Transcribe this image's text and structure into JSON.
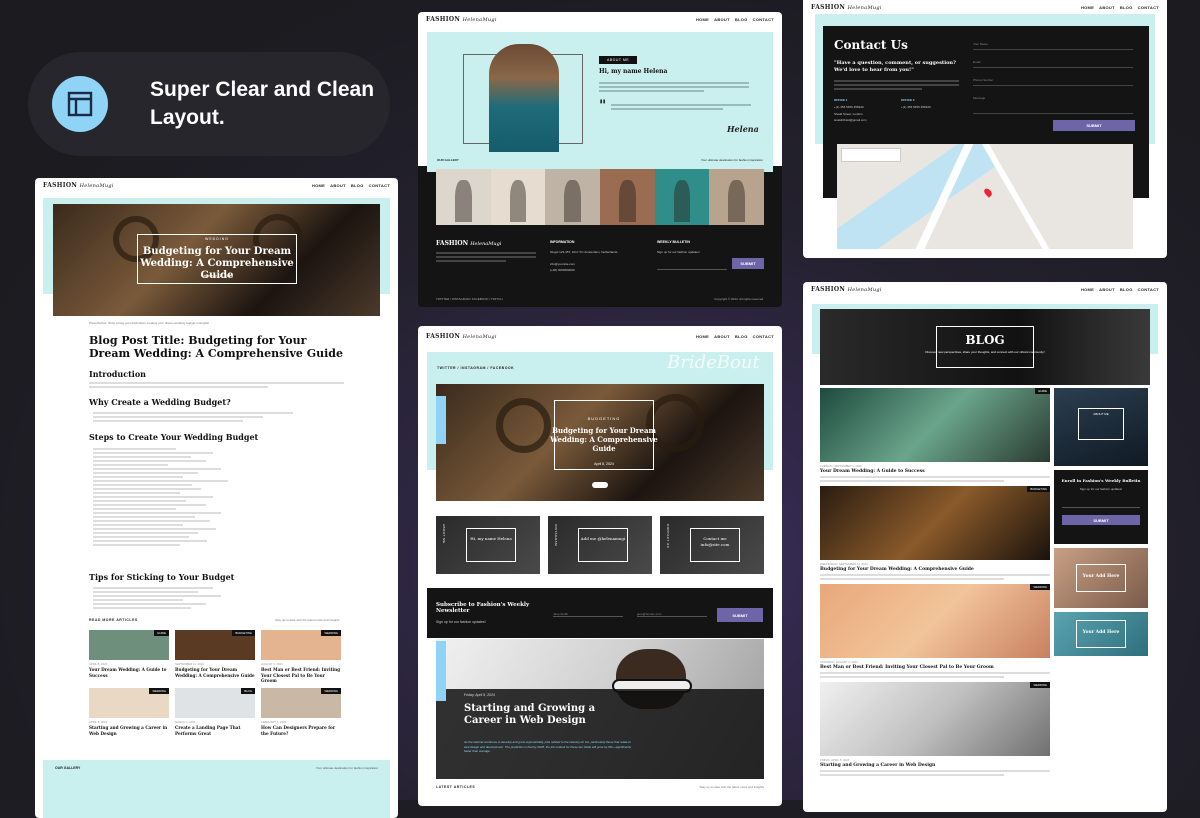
{
  "hero": {
    "title": "Super Clear and Clean Layout."
  },
  "colors": {
    "accent": "#8fd4f7",
    "mint": "#c9f0ee",
    "purple": "#6e64a8"
  },
  "brand": {
    "logo": "FASHION",
    "script": "HelenaMugi"
  },
  "nav": [
    "HOME",
    "ABOUT",
    "BLOG",
    "CONTACT"
  ],
  "post": {
    "label": "WEDDING",
    "title": "Budgeting for Your Dream Wedding: A Comprehensive Guide",
    "date": "September 11, 2024",
    "page_title": "Blog Post Title: Budgeting for Your Dream Wedding: A Comprehensive Guide",
    "caption": "Photo/Author: Write a blog post draft about creating your dream wedding budget in English",
    "h_intro": "Introduction",
    "h_why": "Why Create a Wedding Budget?",
    "h_steps": "Steps to Create Your Wedding Budget",
    "h_tips": "Tips for Sticking to Your Budget",
    "read_more": "READ MORE ARTICLES",
    "stay": "Stay up-to-date with the latest news and insights",
    "gallery": "OUR GALLERY",
    "gallery_note": "Your ultimate destination for fashion inspiration",
    "related": [
      {
        "tag": "GUIDE",
        "title": "Your Dream Wedding: A Guide to Success",
        "date": "APRIL 8, 2024"
      },
      {
        "tag": "BUDGETING",
        "title": "Budgeting for Your Dream Wedding: A Comprehensive Guide",
        "date": "SEPTEMBER 11, 2024"
      },
      {
        "tag": "WEDDING",
        "title": "Best Man or Best Friend: Inviting Your Closest Pal to Be Your Groom",
        "date": "AUGUST 2, 2024"
      },
      {
        "tag": "WEDDING",
        "title": "Starting and Growing a Career in Web Design",
        "date": "APRIL 8, 2024"
      },
      {
        "tag": "BLOG",
        "title": "Create a Landing Page That Performs Great",
        "date": "MARCH 3, 2024"
      },
      {
        "tag": "WEDDING",
        "title": "How Can Designers Prepare for the Future?",
        "date": "FEBRUARY 4, 2024"
      }
    ]
  },
  "about": {
    "label": "ABOUT ME",
    "greeting": "Hi, my name Helena",
    "signature": "Helena",
    "gallery": "OUR GALLERY",
    "gallery_note": "Your ultimate destination for fashion inspiration",
    "info_h": "INFORMATION",
    "address": "Singel 123-457, 1017 XC Amsterdam, Netherlands",
    "email": "info@yoursite.com",
    "phone": "(+48) 0000000000",
    "weekly_h": "WEEKLY BULLETIN",
    "weekly_sub": "Sign up for our fashion updates!",
    "submit": "SUBMIT",
    "footer_left": "TWITTER / INSTAGRAM / FACEBOOK / TWITCH",
    "footer_right": "Copyright © 2024. All rights reserved."
  },
  "contact": {
    "title": "Contact Us",
    "question": "\"Have a question, comment, or suggestion? We'd love to hear from you!\"",
    "office1": "OFFICE 1",
    "office2": "OFFICE 2",
    "phone1": "+(1) 456 5456 456940",
    "phone2": "+(1) 456 5456 456940",
    "addr": "Sivald Street, London",
    "email": "sivaldrithstd@gmail.com",
    "f_name": "Your Name",
    "f_email": "Email",
    "f_phone": "Phone Number",
    "f_msg": "Message",
    "submit": "SUBMIT"
  },
  "home": {
    "social": [
      "TWITTER",
      "INSTAGRAM",
      "FACEBOOK"
    ],
    "watermark": "BrideBout",
    "label": "BUDGETING",
    "title": "Budgeting for Your Dream Wedding: A Comprehensive Guide",
    "date": "April 8, 2024",
    "side": "TRENDWEDDING",
    "tiles": [
      {
        "v": "ABOUT ME",
        "t": "Hi, my name Helena"
      },
      {
        "v": "INSTAGRAM",
        "t": "Add me @helenamugi"
      },
      {
        "v": "CONTACT US",
        "t": "Contact me info@site.com"
      }
    ],
    "sub_title": "Subscribe to Fashion's Weekly Newsletter",
    "sub_note": "Sign up for our fashion updates!",
    "f_name": "Jane Smith",
    "f_email": "jane@human.com",
    "submit": "SUBMIT",
    "feat_side": "LATEST POSTS",
    "feat_date": "Friday, April 5, 2024",
    "feat_title": "Starting and Growing a Career in Web Design",
    "feat_text": "As the internet continues to develop and grow exponentially, jobs related to the industry do too, particularly those that relate to web design and development. The prediction is that by 2028, the job outlook for these two fields will grow by 8%—significantly faster than average.",
    "latest": "LATEST ARTICLES",
    "stay": "Stay up-to-date with the latest news and insights"
  },
  "blog": {
    "title": "BLOG",
    "sub": "Discover new perspectives, share your thoughts, and connect with our vibrant community!",
    "enroll": "Enroll in Fashion's Weekly Bulletin",
    "enroll_sub": "Sign up for our fashion updates!",
    "submit": "SUBMIT",
    "about": "ABOUT ME",
    "ad1": "Your Add Here",
    "ad2": "Your Add Here",
    "posts": [
      {
        "tag": "GUIDE",
        "date": "TUESDAY, SEPTEMBER 3, 2024",
        "title": "Your Dream Wedding: A Guide to Success"
      },
      {
        "tag": "BUDGETING",
        "date": "WEDNESDAY, SEPTEMBER 11, 2024",
        "title": "Budgeting for Your Dream Wedding: A Comprehensive Guide"
      },
      {
        "tag": "WEDDING",
        "date": "SATURDAY, AUGUST 3, 2024",
        "title": "Best Man or Best Friend: Inviting Your Closest Pal to Be Your Groom"
      },
      {
        "tag": "WEDDING",
        "date": "FRIDAY, APRIL 5, 2024",
        "title": "Starting and Growing a Career in Web Design"
      }
    ]
  }
}
